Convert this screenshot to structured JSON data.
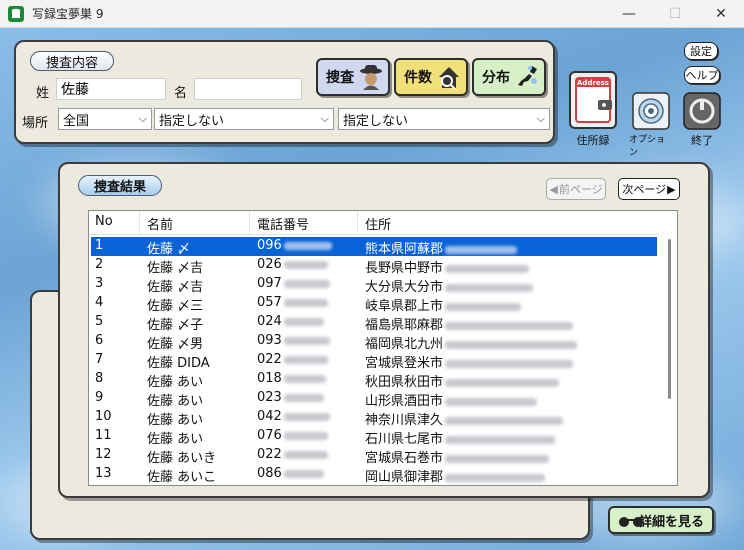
{
  "window": {
    "title": "写録宝夢巣 9"
  },
  "search_panel": {
    "label": "捜査内容",
    "surname_label": "姓",
    "surname_value": "佐藤",
    "given_label": "名",
    "given_value": "",
    "place_label": "場所",
    "selects": [
      "全国",
      "指定しない",
      "指定しない"
    ],
    "buttons": {
      "search": "捜査",
      "count": "件数",
      "distribution": "分布"
    }
  },
  "right_icons": {
    "settings": "設定",
    "help": "ヘルプ",
    "address_book": "住所録",
    "address_badge": "Address",
    "options": "オプション",
    "exit": "終了"
  },
  "results": {
    "label": "捜査結果",
    "prev": "前ページ",
    "next": "次ページ",
    "columns": [
      "No",
      "名前",
      "電話番号",
      "住所"
    ],
    "rows": [
      {
        "no": "1",
        "name": "佐藤 〆",
        "tel": "096",
        "addr": "熊本県阿蘇郡"
      },
      {
        "no": "2",
        "name": "佐藤 〆吉",
        "tel": "026",
        "addr": "長野県中野市"
      },
      {
        "no": "3",
        "name": "佐藤 〆吉",
        "tel": "097",
        "addr": "大分県大分市"
      },
      {
        "no": "4",
        "name": "佐藤 〆三",
        "tel": "057",
        "addr": "岐阜県郡上市"
      },
      {
        "no": "5",
        "name": "佐藤 〆子",
        "tel": "024",
        "addr": "福島県耶麻郡"
      },
      {
        "no": "6",
        "name": "佐藤 〆男",
        "tel": "093",
        "addr": "福岡県北九州"
      },
      {
        "no": "7",
        "name": "佐藤 DIDA",
        "tel": "022",
        "addr": "宮城県登米市"
      },
      {
        "no": "8",
        "name": "佐藤 あい",
        "tel": "018",
        "addr": "秋田県秋田市"
      },
      {
        "no": "9",
        "name": "佐藤 あい",
        "tel": "023",
        "addr": "山形県酒田市"
      },
      {
        "no": "10",
        "name": "佐藤 あい",
        "tel": "042",
        "addr": "神奈川県津久"
      },
      {
        "no": "11",
        "name": "佐藤 あい",
        "tel": "076",
        "addr": "石川県七尾市"
      },
      {
        "no": "12",
        "name": "佐藤 あいき",
        "tel": "022",
        "addr": "宮城県石巻市"
      },
      {
        "no": "13",
        "name": "佐藤 あいこ",
        "tel": "086",
        "addr": "岡山県御津郡"
      }
    ],
    "selected_row": 0,
    "detail_button": "詳細を見る"
  },
  "colors": {
    "selection": "#0a63d6",
    "panel": "#ece9de",
    "sky": "#7fb0dc"
  }
}
